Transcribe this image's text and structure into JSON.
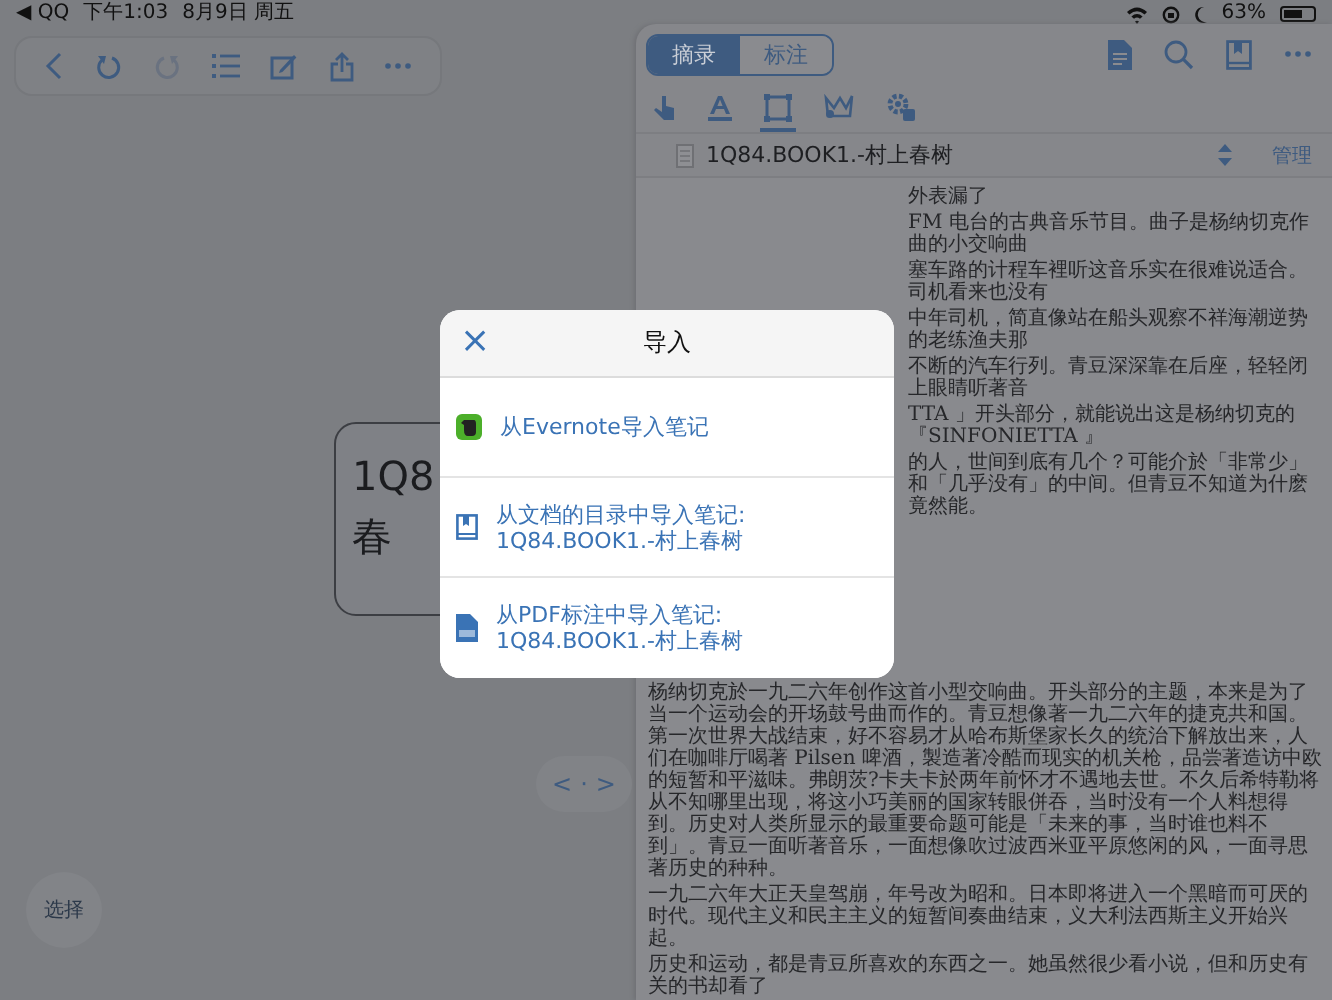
{
  "status_bar": {
    "back_app": "◀ QQ",
    "time": "下午1:03",
    "date": "8月9日 周五",
    "battery": "63%"
  },
  "toolbar": [
    {
      "kind": "back",
      "disabled": false
    },
    {
      "kind": "undo",
      "disabled": false
    },
    {
      "kind": "redo",
      "disabled": true
    },
    {
      "kind": "list",
      "disabled": false
    },
    {
      "kind": "edit",
      "disabled": false
    },
    {
      "kind": "share",
      "disabled": false
    },
    {
      "kind": "more",
      "disabled": false
    }
  ],
  "canvas": {
    "node_lines": [
      "1Q8",
      "春"
    ]
  },
  "pager": {
    "prev": "<",
    "dot": "·",
    "next": ">"
  },
  "select_button": "选择",
  "panel": {
    "tabs": [
      {
        "label": "摘录",
        "selected": true
      },
      {
        "label": "标注",
        "selected": false
      }
    ],
    "header_icons": [
      {
        "kind": "document"
      },
      {
        "kind": "search"
      },
      {
        "kind": "book"
      },
      {
        "kind": "more"
      }
    ],
    "tools": [
      {
        "kind": "pointer",
        "selected": false
      },
      {
        "kind": "highlight",
        "selected": false
      },
      {
        "kind": "rect",
        "selected": true
      },
      {
        "kind": "lasso",
        "selected": false
      },
      {
        "kind": "gear",
        "selected": false
      }
    ],
    "document": {
      "title": "1Q84.BOOK1.-村上春树",
      "manage": "管理"
    },
    "page": {
      "fragments": [
        "外表漏了",
        "FM 电台的古典音乐节目。曲子是杨纳切克作曲的小交响曲",
        "塞车路的计程车裡听这音乐实在很难说适合。司机看来也没有",
        "中年司机，简直像站在船头观察不祥海潮逆势的老练渔夫那",
        "不断的汽车行列。青豆深深靠在后座，轻轻闭上眼睛听著音",
        "TTA 」开头部分，就能说出这是杨纳切克的『SINFONIETTA 』"
      ],
      "paragraphs": [
        "的人，世间到底有几个？可能介於「非常少」和「几乎没有」的中间。但青豆不知道为什麽竟然能。",
        "杨纳切克於一九二六年创作这首小型交响曲。开头部分的主题，本来是为了当一个运动会的开场鼓号曲而作的。青豆想像著一九二六年的捷克共和国。第一次世界大战结束，好不容易才从哈布斯堡家长久的统治下解放出来，人们在咖啡厅喝著 Pilsen 啤酒，製造著冷酷而现实的机关枪，品尝著造访中欧的短暂和平滋味。弗朗茨?卡夫卡於两年前怀才不遇地去世。不久后希特勒将从不知哪里出现，将这小巧美丽的国家转眼併吞，当时没有一个人料想得到。历史对人类所显示的最重要命题可能是「未来的事，当时谁也料不到」。青豆一面听著音乐，一面想像吹过波西米亚平原悠闲的风，一面寻思著历史的种种。",
        "一九二六年大正天皇驾崩，年号改为昭和。日本即将进入一个黑暗而可厌的时代。现代主义和民主主义的短暂间奏曲结束，义大利法西斯主义开始兴起。",
        "历史和运动，都是青豆所喜欢的东西之一。她虽然很少看小说，但和历史有关的书却看了"
      ]
    }
  },
  "dialog": {
    "close": "×",
    "title": "导入",
    "items": [
      {
        "kind": "evernote",
        "text": "从Evernote导入笔记"
      },
      {
        "kind": "toc",
        "text": "从文档的目录中导入笔记: 1Q84.BOOK1.-村上春树"
      },
      {
        "kind": "pdf",
        "text": "从PDF标注中导入笔记: 1Q84.BOOK1.-村上春树"
      }
    ]
  }
}
